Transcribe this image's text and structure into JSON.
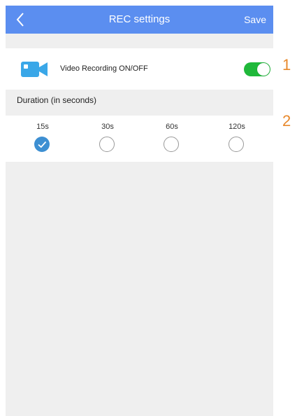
{
  "header": {
    "title": "REC settings",
    "save_label": "Save",
    "back_icon": "chevron-left-icon"
  },
  "recording": {
    "icon": "video-camera-icon",
    "label": "Video Recording ON/OFF",
    "enabled": true
  },
  "duration": {
    "title": "Duration (in seconds)",
    "options": [
      {
        "label": "15s",
        "selected": true
      },
      {
        "label": "30s",
        "selected": false
      },
      {
        "label": "60s",
        "selected": false
      },
      {
        "label": "120s",
        "selected": false
      }
    ]
  },
  "annotations": [
    "1",
    "2"
  ],
  "colors": {
    "header_bg": "#5b8ef0",
    "toggle_on": "#1fb83a",
    "radio_checked": "#3d8fd2",
    "camera_icon": "#3aa7e8",
    "annotation": "#e8892c"
  }
}
